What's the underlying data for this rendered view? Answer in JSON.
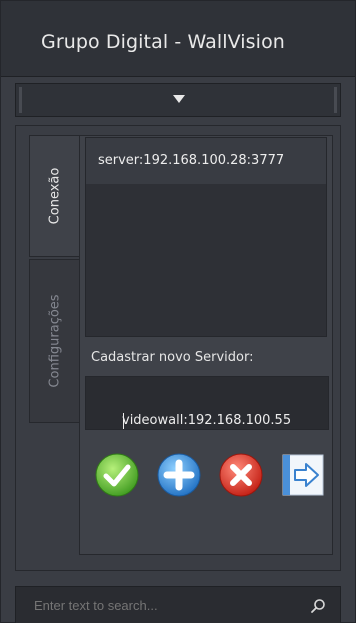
{
  "window": {
    "title": "Grupo Digital - WallVision",
    "logo_icon": "crescent-logo-icon"
  },
  "dropdown": {
    "icon": "caret-down-icon"
  },
  "tabs": [
    {
      "label": "Conexão",
      "active": true
    },
    {
      "label": "Configurações",
      "active": false
    }
  ],
  "servers": {
    "items": [
      "server:192.168.100.28:3777"
    ]
  },
  "register": {
    "label": "Cadastrar novo Servidor:",
    "input_value": "videowall:192.168.100.55"
  },
  "actions": [
    {
      "name": "confirm",
      "icon": "check-icon",
      "color": "#5cb83a"
    },
    {
      "name": "add",
      "icon": "plus-icon",
      "color": "#3b8fd9"
    },
    {
      "name": "delete",
      "icon": "x-icon",
      "color": "#d9342b"
    },
    {
      "name": "connect",
      "icon": "arrow-right-icon",
      "color": "#4a90d9"
    }
  ],
  "search": {
    "placeholder": "Enter text to search...",
    "icon": "search-icon"
  }
}
